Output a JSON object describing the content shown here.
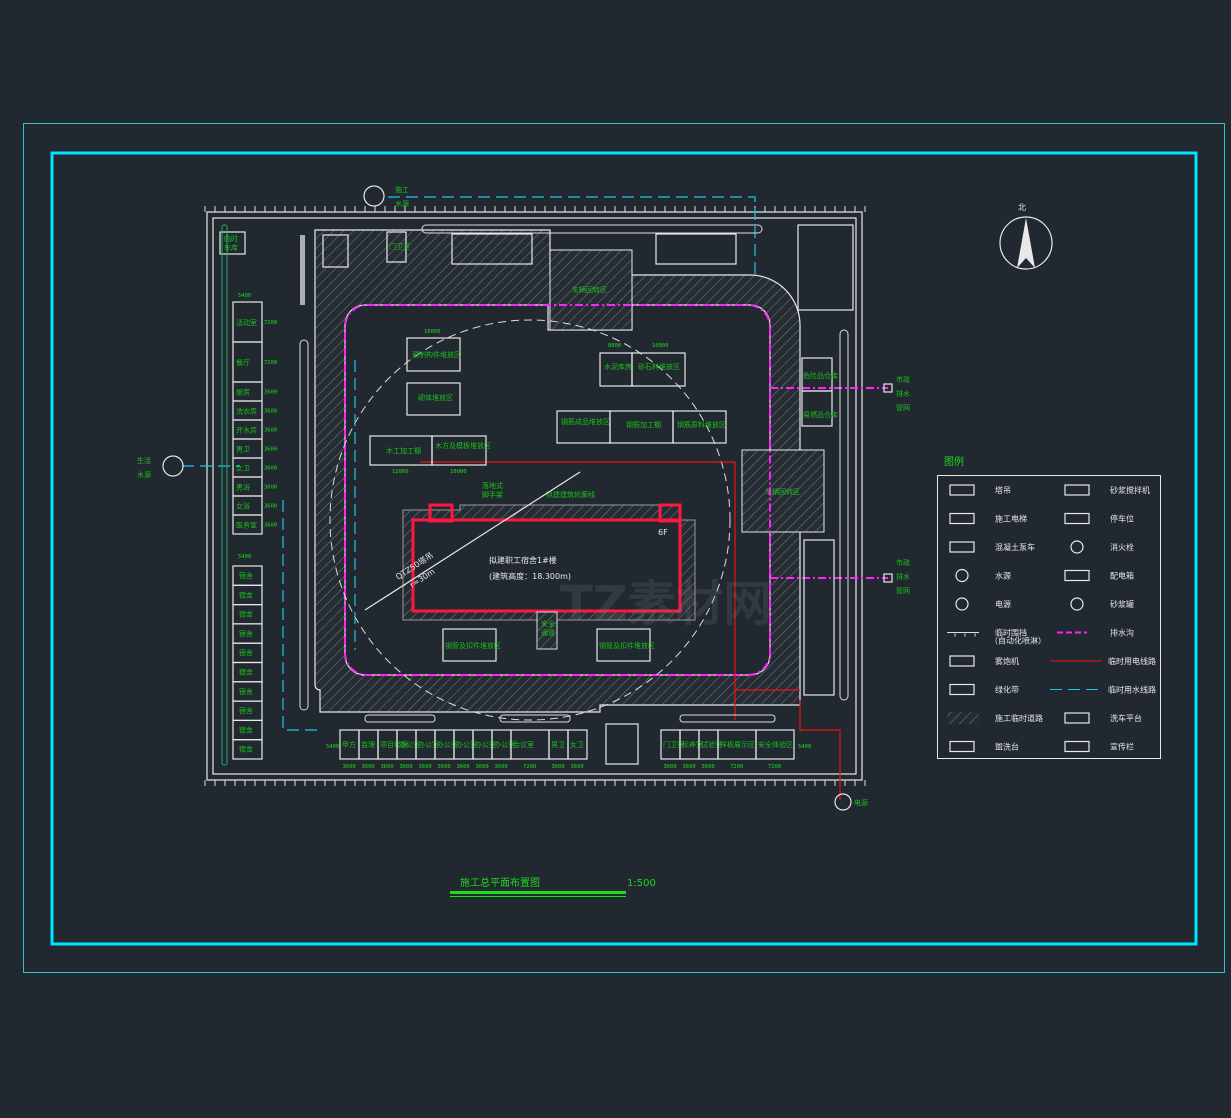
{
  "title": "施工总平面布置图",
  "scale": "1:500",
  "north_label": "北",
  "watermark": "TZ素材网 TZSUCAI.COM",
  "colors": {
    "background": "#212830",
    "frame": "#00e5ff",
    "text": "#19c219",
    "building": "#ff1744",
    "drain": "#ff22ff",
    "power_line": "#ee1111",
    "water_line": "#19c8e6"
  },
  "sources": {
    "construction_water": [
      "施工",
      "水源"
    ],
    "domestic_water": [
      "生活",
      "水源"
    ],
    "drain_1": [
      "市政",
      "排水",
      "管网"
    ],
    "drain_2": [
      "市政",
      "排水",
      "管网"
    ],
    "power": "电源"
  },
  "building": {
    "name": "拟建职工宿舍1#楼",
    "height": "(建筑高度：18.300m)",
    "floors": "6F"
  },
  "crane": {
    "model": "QTZ50塔吊",
    "radius": "r=30m"
  },
  "left_top": {
    "garage": [
      "临时",
      "车库"
    ],
    "width_dim": "5400",
    "rooms": [
      {
        "name": "活动室",
        "dim": "7200"
      },
      {
        "name": "餐厅",
        "dim": "7200"
      },
      {
        "name": "厨房",
        "dim": "3600"
      },
      {
        "name": "洗衣房",
        "dim": "3600"
      },
      {
        "name": "开水房",
        "dim": "3600"
      },
      {
        "name": "男卫",
        "dim": "3600"
      },
      {
        "name": "女卫",
        "dim": "3600"
      },
      {
        "name": "男浴",
        "dim": "3600"
      },
      {
        "name": "女浴",
        "dim": "3600"
      },
      {
        "name": "医务室",
        "dim": "3600"
      }
    ]
  },
  "left_bottom": {
    "width_dim": "5400",
    "rooms": [
      "宿舍",
      "宿舍",
      "宿舍",
      "宿舍",
      "宿舍",
      "宿舍",
      "宿舍",
      "宿舍",
      "宿舍",
      "宿舍"
    ]
  },
  "bottom_offices": {
    "height_dim": "5400",
    "rooms": [
      {
        "name": "甲方",
        "dim": "3600"
      },
      {
        "name": "监理",
        "dim": "3600"
      },
      {
        "name": "项目经理",
        "dim": "3600"
      },
      {
        "name": "办公室",
        "dim": "3600"
      },
      {
        "name": "办公室",
        "dim": "3600"
      },
      {
        "name": "办公室",
        "dim": "3600"
      },
      {
        "name": "办公室",
        "dim": "3600"
      },
      {
        "name": "办公室",
        "dim": "3600"
      },
      {
        "name": "办公室",
        "dim": "3600"
      },
      {
        "name": "会议室",
        "dim": "7200"
      },
      {
        "name": "男卫",
        "dim": "3600"
      },
      {
        "name": "女卫",
        "dim": "3600"
      }
    ]
  },
  "bottom_right": {
    "height_dim": "5400",
    "rooms": [
      {
        "name": "门卫室",
        "dim": "3600"
      },
      {
        "name": "标养室",
        "dim": "3600"
      },
      {
        "name": "试验室",
        "dim": "3600"
      },
      {
        "name": "样板展示区",
        "dim": "7200"
      },
      {
        "name": "安全体验区",
        "dim": "7200"
      }
    ]
  },
  "gate_house": {
    "name": "门卫室",
    "w": "3600",
    "h": "5400"
  },
  "zones": {
    "precast": "预制构件堆放区",
    "precast_w": "10000",
    "precast_h": "4000",
    "masonry": "砌体堆放区",
    "masonry_w": "10000",
    "masonry_h": "4000",
    "carpentry": "木工加工棚",
    "carpentry_w": "12000",
    "carpentry_h": "4000",
    "formwork": "木方及模板堆放区",
    "formwork_w": "10000",
    "cement": "水泥库房",
    "cement_w": "8000",
    "cement_h": "6000",
    "aggregate": "砂石料堆放区",
    "aggregate_w": "10000",
    "rebar_done": "钢筋成品堆放区",
    "rebar_done_w": "10000",
    "rebar_shed": "钢筋加工棚",
    "rebar_shed_w": "12000",
    "rebar_raw": "钢筋原料堆放区",
    "rebar_raw_w": "10000",
    "rebar_h": "6000",
    "scaffold": [
      "落地式",
      "脚手架"
    ],
    "outline": "拟建建筑轮廓线",
    "pipe_1": "钢管及扣件堆放区",
    "pipe_2": "钢管及扣件堆放区",
    "pipe_w": "10000",
    "pipe_h": "6000",
    "safe_passage": [
      "安全",
      "通道"
    ],
    "turn_top": "车辆回转区",
    "turn_top_w": "15000",
    "turn_top_h": "4500",
    "turn_right": "车辆回转区",
    "turn_right_dims": [
      "4500",
      "6000",
      "4500"
    ],
    "turn_right_h": "9000",
    "danger_store": "危险品仓库",
    "flammable_store": "易燃品仓库"
  },
  "legend": {
    "title": "图例",
    "items": [
      {
        "icon": "tower-crane-icon",
        "label": "塔吊"
      },
      {
        "icon": "mortar-mixer-icon",
        "label": "砂浆搅拌机"
      },
      {
        "icon": "construction-elevator-icon",
        "label": "施工电梯"
      },
      {
        "icon": "parking-space-icon",
        "label": "停车位"
      },
      {
        "icon": "concrete-pump-truck-icon",
        "label": "混凝土泵车"
      },
      {
        "icon": "fire-hydrant-icon",
        "label": "消火栓"
      },
      {
        "icon": "water-source-icon",
        "label": "水源"
      },
      {
        "icon": "distribution-box-icon",
        "label": "配电箱"
      },
      {
        "icon": "power-source-icon",
        "label": "电源"
      },
      {
        "icon": "mortar-tank-icon",
        "label": "砂浆罐"
      },
      {
        "icon": "temporary-fence-icon",
        "label": "临时围挡",
        "sub": "（自动化喷淋）"
      },
      {
        "icon": "drain-ditch-icon",
        "label": "排水沟"
      },
      {
        "icon": "fog-cannon-icon",
        "label": "雾炮机"
      },
      {
        "icon": "power-line-icon",
        "label": "临时用电线路"
      },
      {
        "icon": "green-belt-icon",
        "label": "绿化带"
      },
      {
        "icon": "water-line-icon",
        "label": "临时用水线路"
      },
      {
        "icon": "temporary-road-icon",
        "label": "施工临时道路"
      },
      {
        "icon": "car-wash-platform-icon",
        "label": "洗车平台"
      },
      {
        "icon": "wash-basin-icon",
        "label": "盥洗台"
      },
      {
        "icon": "bulletin-board-icon",
        "label": "宣传栏"
      }
    ]
  }
}
